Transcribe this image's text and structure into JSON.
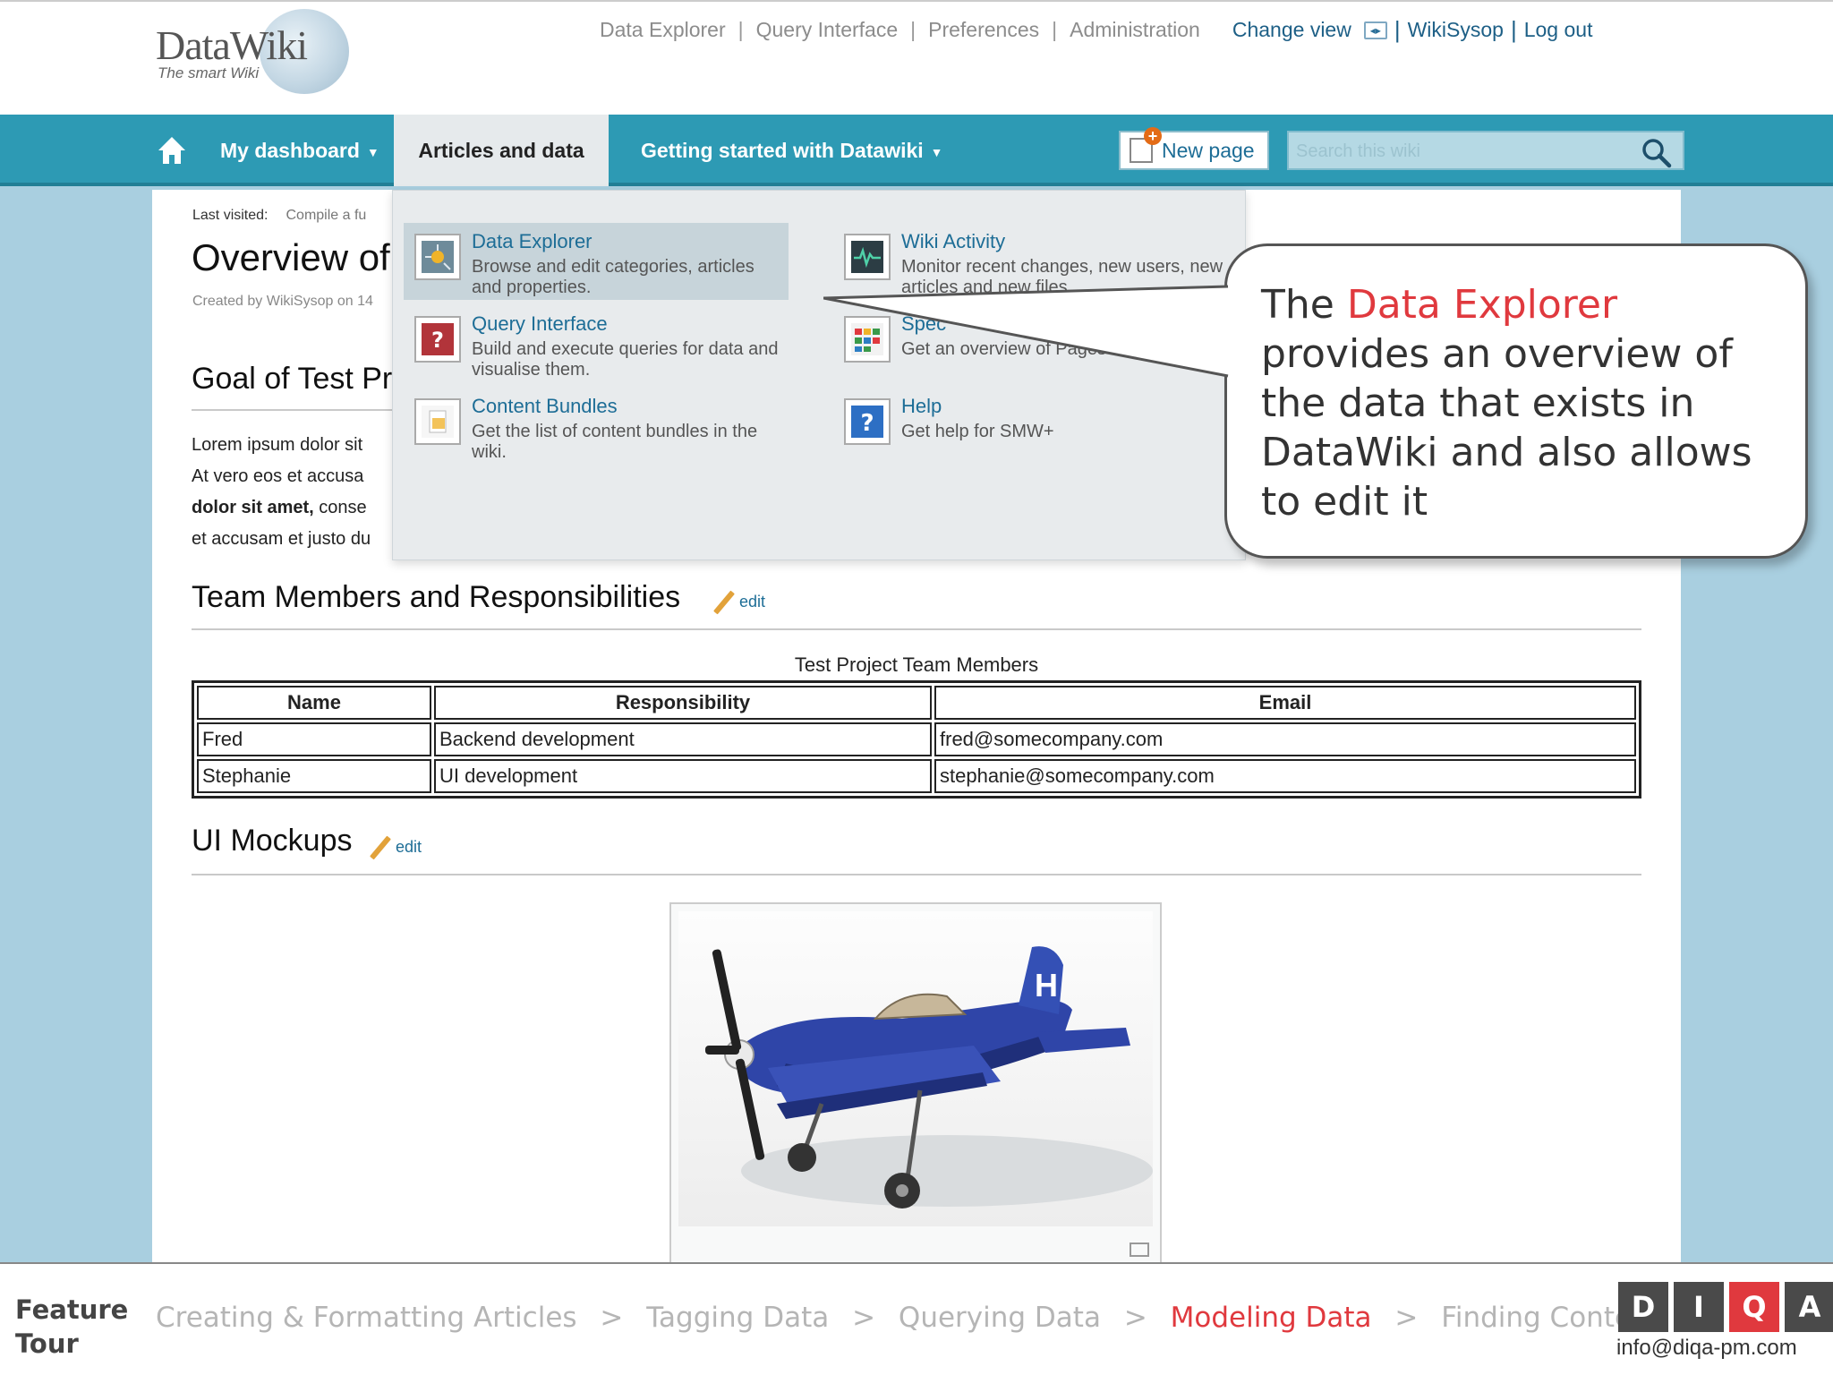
{
  "header": {
    "logo_name": "DataWiki",
    "logo_tagline": "The smart Wiki",
    "links": [
      "Data Explorer",
      "Query Interface",
      "Preferences",
      "Administration"
    ],
    "change_view": "Change view",
    "user": "WikiSysop",
    "logout": "Log out"
  },
  "nav": {
    "dashboard": "My dashboard",
    "articles": "Articles and data",
    "getting_started": "Getting started with Datawiki",
    "new_page": "New page",
    "search_placeholder": "Search this wiki"
  },
  "page": {
    "last_visited_label": "Last visited:",
    "last_visited_value": "Compile a fu",
    "title": "Overview of",
    "created_by": "Created by WikiSysop on 14",
    "goal_heading": "Goal of Test Pr",
    "lorem_lines": [
      "Lorem ipsum dolor sit",
      "At vero eos et accusa",
      "dolor sit amet,",
      " conse",
      "et accusam et justo du"
    ],
    "team_heading": "Team Members and Responsibilities",
    "edit": "edit",
    "table_caption": "Test Project Team Members",
    "table_headers": [
      "Name",
      "Responsibility",
      "Email"
    ],
    "table_rows": [
      [
        "Fred",
        "Backend development",
        "fred@somecompany.com"
      ],
      [
        "Stephanie",
        "UI development",
        "stephanie@somecompany.com"
      ]
    ],
    "mockups_heading": "UI Mockups"
  },
  "dropdown": {
    "items": [
      {
        "title": "Data Explorer",
        "desc": "Browse and edit categories, articles and properties.",
        "icon": "data-explorer-icon"
      },
      {
        "title": "Query Interface",
        "desc": "Build and execute queries for data and visualise them.",
        "icon": "query-interface-icon"
      },
      {
        "title": "Content Bundles",
        "desc": "Get the list of content bundles in the wiki.",
        "icon": "content-bundles-icon"
      },
      {
        "title": "Wiki Activity",
        "desc": "Monitor recent changes, new users, new articles and new files",
        "icon": "wiki-activity-icon"
      },
      {
        "title": "Spec",
        "desc": "Get an overview of  Pages",
        "icon": "special-pages-icon"
      },
      {
        "title": "Help",
        "desc": "Get help for SMW+",
        "icon": "help-icon"
      }
    ]
  },
  "callout": {
    "pre": "The ",
    "highlight": "Data Explorer",
    "post": " provides an overview of the data that exists in DataWiki and also allows to edit it"
  },
  "footer": {
    "label_1": "Feature",
    "label_2": "Tour",
    "crumbs": [
      "Creating & Formatting Articles",
      "Tagging Data",
      "Querying Data",
      "Modeling Data",
      "Finding Content"
    ],
    "separator": ">",
    "current_index": 3,
    "logo_letters": [
      "D",
      "I",
      "Q",
      "A"
    ],
    "email": "info@diqa-pm.com"
  },
  "colors": {
    "nav": "#2d9ab4",
    "accent_red": "#e0393e",
    "link": "#1d6d96"
  }
}
